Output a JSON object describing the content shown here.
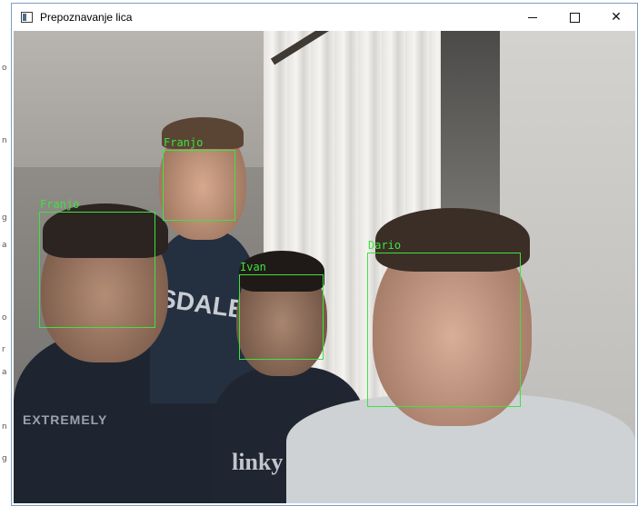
{
  "window": {
    "title": "Prepoznavanje lica",
    "controls": {
      "minimize": "–",
      "maximize": "□",
      "close": "✕"
    }
  },
  "side_strip_text": [
    "o",
    "n",
    "g",
    "a",
    "o",
    "r",
    "a",
    "n",
    "g"
  ],
  "scene": {
    "shirt_text_1": "SDALE",
    "shirt_text_2": "EXTREMELY",
    "shirt_text_3": "linky"
  },
  "faces": [
    {
      "label": "Franjo"
    },
    {
      "label": "Franjo"
    },
    {
      "label": "Ivan"
    },
    {
      "label": "Dario"
    }
  ],
  "colors": {
    "detection": "#3fe23f",
    "window_border": "#7a9fc9"
  }
}
